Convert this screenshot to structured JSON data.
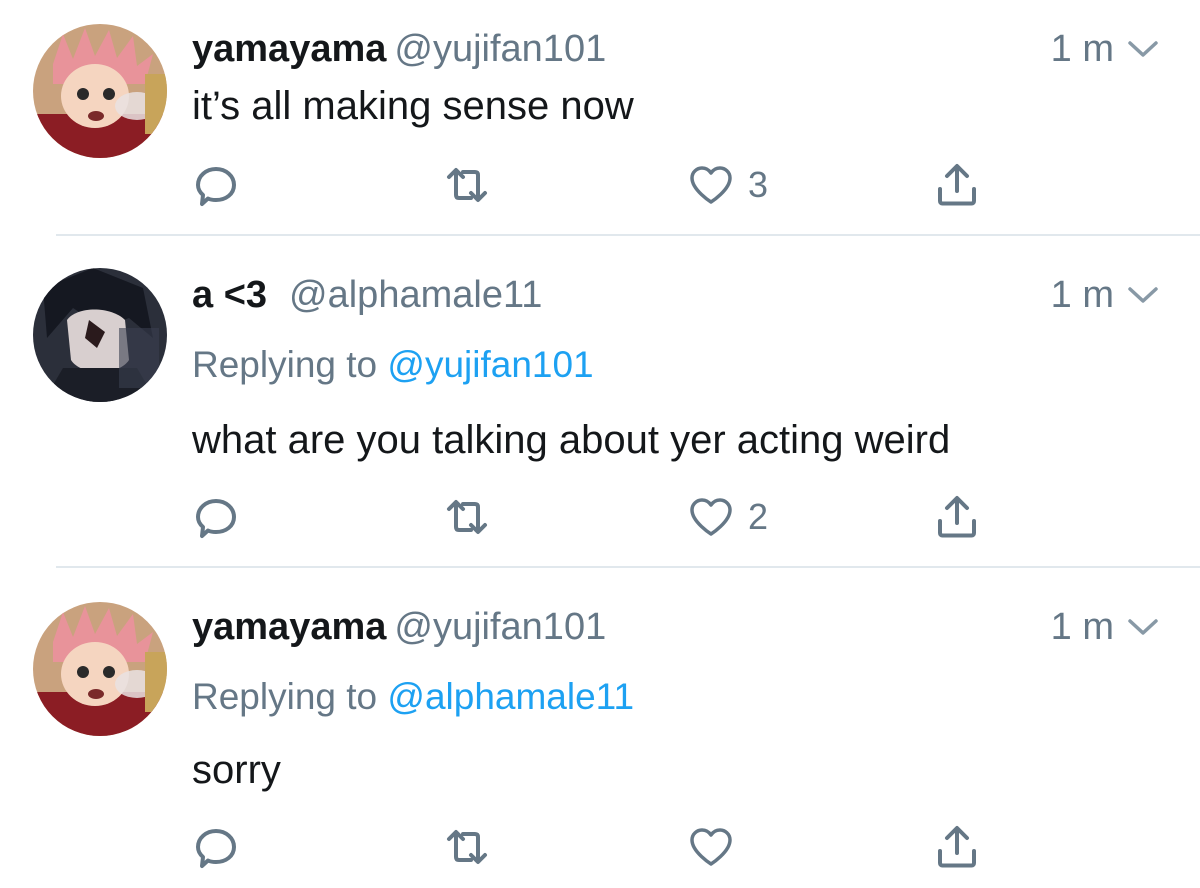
{
  "tweets": [
    {
      "display_name": "yamayama",
      "handle": "@yujifan101",
      "time": "1 m",
      "avatar": "avatar-pink-haired-character",
      "replying_label": "",
      "replying_to": "",
      "text": "it’s all making sense now",
      "like_count": "3"
    },
    {
      "display_name": "a <3",
      "handle": "@alphamale11",
      "time": "1 m",
      "avatar": "avatar-dark-haired-character",
      "replying_label": "Replying to",
      "replying_to": "@yujifan101",
      "text": "what are you talking about yer acting weird",
      "like_count": "2"
    },
    {
      "display_name": "yamayama",
      "handle": "@yujifan101",
      "time": "1 m",
      "avatar": "avatar-pink-haired-character",
      "replying_label": "Replying to",
      "replying_to": "@alphamale11",
      "text": "sorry",
      "like_count": ""
    }
  ],
  "icons": {
    "reply": "reply-icon",
    "retweet": "retweet-icon",
    "like": "heart-icon",
    "share": "share-icon",
    "caret": "chevron-down-icon"
  },
  "colors": {
    "text": "#14171a",
    "secondary": "#657786",
    "link": "#1da1f2",
    "divider": "#e1e8ed"
  }
}
